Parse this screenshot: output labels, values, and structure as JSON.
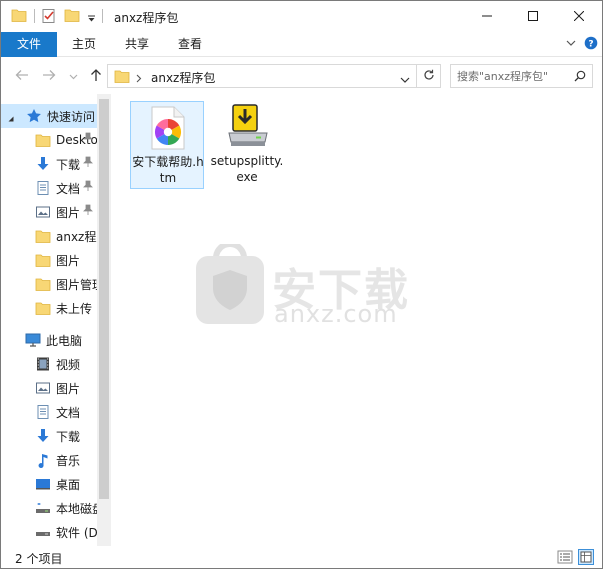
{
  "window": {
    "title": "anxz程序包",
    "minimize_icon": "minimize-icon",
    "maximize_icon": "maximize-icon",
    "close_icon": "close-icon"
  },
  "ribbon": {
    "tabs": [
      {
        "label": "文件",
        "active": true
      },
      {
        "label": "主页"
      },
      {
        "label": "共享"
      },
      {
        "label": "查看"
      }
    ]
  },
  "address": {
    "path": "anxz程序包",
    "search_placeholder": "搜索\"anxz程序包\""
  },
  "nav": {
    "items": [
      {
        "label": "快速访问",
        "icon": "star-icon",
        "selected": true
      },
      {
        "label": "Desktop",
        "icon": "folder-icon",
        "pinned": true
      },
      {
        "label": "下载",
        "icon": "download-icon",
        "pinned": true
      },
      {
        "label": "文档",
        "icon": "document-icon",
        "pinned": true
      },
      {
        "label": "图片",
        "icon": "picture-icon",
        "pinned": true
      },
      {
        "label": "anxz程序包",
        "icon": "folder-icon"
      },
      {
        "label": "图片",
        "icon": "folder-icon"
      },
      {
        "label": "图片管理",
        "icon": "folder-icon"
      },
      {
        "label": "未上传",
        "icon": "folder-icon"
      },
      {
        "label": "此电脑",
        "icon": "computer-icon"
      },
      {
        "label": "视频",
        "icon": "video-icon"
      },
      {
        "label": "图片",
        "icon": "picture-icon"
      },
      {
        "label": "文档",
        "icon": "document-icon"
      },
      {
        "label": "下载",
        "icon": "download-icon"
      },
      {
        "label": "音乐",
        "icon": "music-icon"
      },
      {
        "label": "桌面",
        "icon": "desktop-icon"
      },
      {
        "label": "本地磁盘 (C:)",
        "icon": "drive-icon"
      },
      {
        "label": "软件 (D:)",
        "icon": "drive-icon"
      }
    ]
  },
  "files": [
    {
      "name": "安下载帮助.htm",
      "icon": "browser-html-icon",
      "selected": true
    },
    {
      "name": "setupsplitty.exe",
      "icon": "installer-icon"
    }
  ],
  "watermark": {
    "brand": "安下载",
    "domain": "anxz.com"
  },
  "status": {
    "count": "2 个项目"
  }
}
